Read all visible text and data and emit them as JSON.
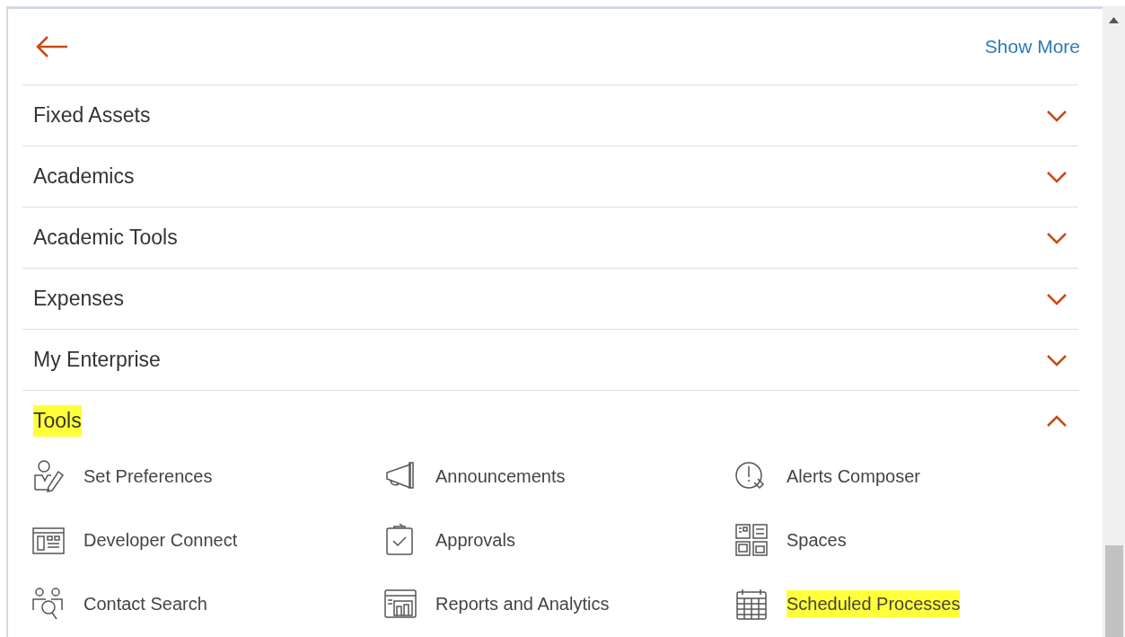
{
  "header": {
    "show_more": "Show More"
  },
  "sections": [
    {
      "label": "Fixed Assets",
      "expanded": false,
      "highlighted": false
    },
    {
      "label": "Academics",
      "expanded": false,
      "highlighted": false
    },
    {
      "label": "Academic Tools",
      "expanded": false,
      "highlighted": false
    },
    {
      "label": "Expenses",
      "expanded": false,
      "highlighted": false
    },
    {
      "label": "My Enterprise",
      "expanded": false,
      "highlighted": false
    },
    {
      "label": "Tools",
      "expanded": true,
      "highlighted": true,
      "items": [
        {
          "label": "Set Preferences",
          "highlighted": false
        },
        {
          "label": "Announcements",
          "highlighted": false
        },
        {
          "label": "Alerts Composer",
          "highlighted": false
        },
        {
          "label": "Developer Connect",
          "highlighted": false
        },
        {
          "label": "Approvals",
          "highlighted": false
        },
        {
          "label": "Spaces",
          "highlighted": false
        },
        {
          "label": "Contact Search",
          "highlighted": false
        },
        {
          "label": "Reports and Analytics",
          "highlighted": false
        },
        {
          "label": "Scheduled Processes",
          "highlighted": true
        }
      ]
    }
  ]
}
